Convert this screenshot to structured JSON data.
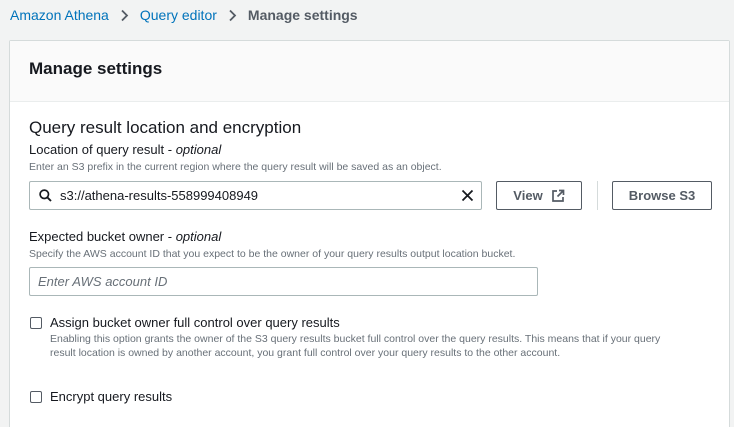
{
  "breadcrumb": {
    "items": [
      "Amazon Athena",
      "Query editor",
      "Manage settings"
    ]
  },
  "panel": {
    "title": "Manage settings"
  },
  "section": {
    "title": "Query result location and encryption"
  },
  "query_result_location": {
    "label": "Location of query result - ",
    "label_optional": "optional",
    "description": "Enter an S3 prefix in the current region where the query result will be saved as an object.",
    "value": "s3://athena-results-558999408949"
  },
  "buttons": {
    "view": "View",
    "browse_s3": "Browse S3"
  },
  "bucket_owner": {
    "label": "Expected bucket owner - ",
    "label_optional": "optional",
    "description": "Specify the AWS account ID that you expect to be the owner of your query results output location bucket.",
    "placeholder": "Enter AWS account ID"
  },
  "assign_owner": {
    "label": "Assign bucket owner full control over query results",
    "checked": false,
    "description_line1": "Enabling this option grants the owner of the S3 query results bucket full control over the query results. This means that if your query",
    "description_line2": "result location is owned by another account, you grant full control over your query results to the other account."
  },
  "encrypt": {
    "label": "Encrypt query results",
    "checked": false
  },
  "colors": {
    "link": "#0073bb",
    "text": "#16191f",
    "muted": "#687078",
    "border": "#aab7b8"
  }
}
